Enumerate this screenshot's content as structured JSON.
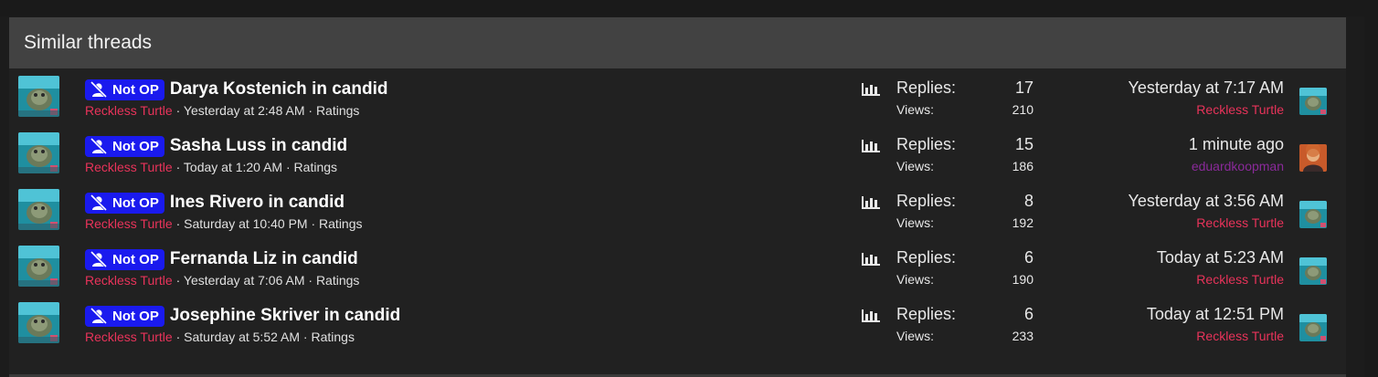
{
  "section": {
    "title": "Similar threads"
  },
  "badge": {
    "label": "Not OP",
    "icon": "not-op-icon"
  },
  "labels": {
    "replies": "Replies:",
    "views": "Views:",
    "ratings": "Ratings",
    "separator": "·"
  },
  "colors": {
    "badge_bg": "#1a1aee",
    "author": "#e8335a",
    "member_purple": "#8a2a9a",
    "header_bg": "#424242",
    "body_bg": "#212121"
  },
  "threads": [
    {
      "title": "Darya Kostenich in candid",
      "author": "Reckless Turtle",
      "date": "Yesterday at 2:48 AM",
      "replies": "17",
      "views": "210",
      "last_time": "Yesterday at 7:17 AM",
      "last_user": "Reckless Turtle"
    },
    {
      "title": "Sasha Luss in candid",
      "author": "Reckless Turtle",
      "date": "Today at 1:20 AM",
      "replies": "15",
      "views": "186",
      "last_time": "1 minute ago",
      "last_user": "eduardkoopman"
    },
    {
      "title": "Ines Rivero in candid",
      "author": "Reckless Turtle",
      "date": "Saturday at 10:40 PM",
      "replies": "8",
      "views": "192",
      "last_time": "Yesterday at 3:56 AM",
      "last_user": "Reckless Turtle"
    },
    {
      "title": "Fernanda Liz in candid",
      "author": "Reckless Turtle",
      "date": "Yesterday at 7:06 AM",
      "replies": "6",
      "views": "190",
      "last_time": "Today at 5:23 AM",
      "last_user": "Reckless Turtle"
    },
    {
      "title": "Josephine Skriver in candid",
      "author": "Reckless Turtle",
      "date": "Saturday at 5:52 AM",
      "replies": "6",
      "views": "233",
      "last_time": "Today at 12:51 PM",
      "last_user": "Reckless Turtle"
    }
  ]
}
